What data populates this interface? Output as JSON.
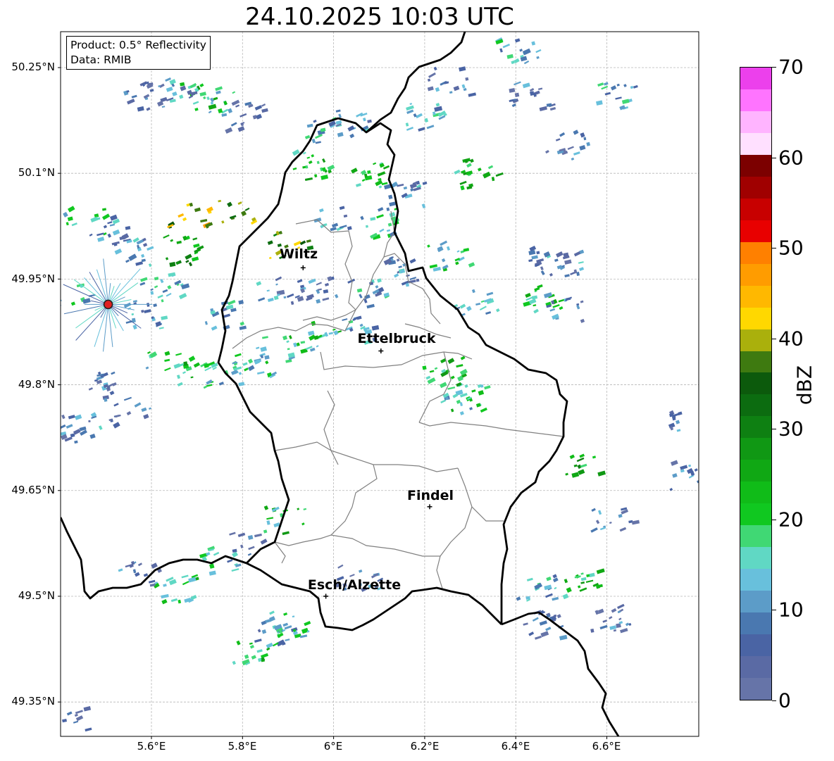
{
  "title": "24.10.2025 10:03 UTC",
  "info": {
    "product": "Product: 0.5° Reflectivity",
    "data": "Data: RMIB"
  },
  "lat_ticks": [
    "50.25°N",
    "50.1°N",
    "49.95°N",
    "49.8°N",
    "49.65°N",
    "49.5°N",
    "49.35°N"
  ],
  "lon_ticks": [
    "5.6°E",
    "5.8°E",
    "6°E",
    "6.2°E",
    "6.4°E",
    "6.6°E"
  ],
  "cities": [
    {
      "name": "Wiltz",
      "lon": 5.933,
      "lat": 49.966
    },
    {
      "name": "Ettelbruck",
      "lon": 6.104,
      "lat": 49.848
    },
    {
      "name": "Findel",
      "lon": 6.211,
      "lat": 49.627
    },
    {
      "name": "Esch/Alzette",
      "lon": 5.983,
      "lat": 49.5
    }
  ],
  "radar_site": {
    "lon": 5.505,
    "lat": 49.914
  },
  "colorbar": {
    "label": "dBZ",
    "ticks": [
      "0",
      "10",
      "20",
      "30",
      "40",
      "50",
      "60",
      "70"
    ],
    "min": 0,
    "max": 70,
    "colors": [
      "#6674a8",
      "#5a6aa4",
      "#4a64a4",
      "#4a78b0",
      "#5c9cc8",
      "#68c0dc",
      "#60d8c4",
      "#40d874",
      "#10c820",
      "#10bc18",
      "#10a814",
      "#109814",
      "#0e8012",
      "#0c6c10",
      "#0c5a0c",
      "#3e7a10",
      "#aab00c",
      "#ffd800",
      "#ffb800",
      "#ff9c00",
      "#ff8000",
      "#e80000",
      "#c80000",
      "#a00000",
      "#7c0000",
      "#ffe0ff",
      "#ffb4ff",
      "#ff74ff",
      "#ec40ec"
    ]
  },
  "echoes": [
    {
      "lon": 5.7,
      "lat": 50.21,
      "dbz": 22
    },
    {
      "lon": 5.75,
      "lat": 50.2,
      "dbz": 18
    },
    {
      "lon": 5.64,
      "lat": 50.22,
      "dbz": 10
    },
    {
      "lon": 5.58,
      "lat": 50.21,
      "dbz": 8
    },
    {
      "lon": 5.8,
      "lat": 50.18,
      "dbz": 6
    },
    {
      "lon": 5.45,
      "lat": 50.03,
      "dbz": 20
    },
    {
      "lon": 5.5,
      "lat": 50.02,
      "dbz": 12
    },
    {
      "lon": 5.66,
      "lat": 49.99,
      "dbz": 28
    },
    {
      "lon": 5.62,
      "lat": 49.94,
      "dbz": 14
    },
    {
      "lon": 5.42,
      "lat": 49.93,
      "dbz": 16
    },
    {
      "lon": 5.58,
      "lat": 49.9,
      "dbz": 12
    },
    {
      "lon": 5.63,
      "lat": 49.83,
      "dbz": 18
    },
    {
      "lon": 5.7,
      "lat": 49.82,
      "dbz": 22
    },
    {
      "lon": 5.76,
      "lat": 49.81,
      "dbz": 16
    },
    {
      "lon": 5.5,
      "lat": 49.8,
      "dbz": 8
    },
    {
      "lon": 5.55,
      "lat": 49.76,
      "dbz": 6
    },
    {
      "lon": 5.44,
      "lat": 49.74,
      "dbz": 10
    },
    {
      "lon": 5.86,
      "lat": 49.85,
      "dbz": 18
    },
    {
      "lon": 5.82,
      "lat": 49.83,
      "dbz": 16
    },
    {
      "lon": 5.92,
      "lat": 49.86,
      "dbz": 20
    },
    {
      "lon": 5.97,
      "lat": 49.87,
      "dbz": 22
    },
    {
      "lon": 6.04,
      "lat": 49.88,
      "dbz": 14
    },
    {
      "lon": 5.87,
      "lat": 49.93,
      "dbz": 10
    },
    {
      "lon": 5.96,
      "lat": 49.94,
      "dbz": 8
    },
    {
      "lon": 6.07,
      "lat": 49.93,
      "dbz": 12
    },
    {
      "lon": 5.97,
      "lat": 50.16,
      "dbz": 14
    },
    {
      "lon": 6.03,
      "lat": 50.17,
      "dbz": 10
    },
    {
      "lon": 5.95,
      "lat": 50.11,
      "dbz": 22
    },
    {
      "lon": 6.08,
      "lat": 50.1,
      "dbz": 24
    },
    {
      "lon": 6.0,
      "lat": 50.04,
      "dbz": 12
    },
    {
      "lon": 6.1,
      "lat": 50.03,
      "dbz": 16
    },
    {
      "lon": 5.9,
      "lat": 50.0,
      "dbz": 38
    },
    {
      "lon": 5.79,
      "lat": 50.05,
      "dbz": 40
    },
    {
      "lon": 5.68,
      "lat": 50.04,
      "dbz": 42
    },
    {
      "lon": 6.15,
      "lat": 50.07,
      "dbz": 10
    },
    {
      "lon": 6.25,
      "lat": 50.23,
      "dbz": 8
    },
    {
      "lon": 6.2,
      "lat": 50.18,
      "dbz": 12
    },
    {
      "lon": 6.4,
      "lat": 50.27,
      "dbz": 14
    },
    {
      "lon": 6.43,
      "lat": 50.21,
      "dbz": 8
    },
    {
      "lon": 6.31,
      "lat": 50.1,
      "dbz": 24
    },
    {
      "lon": 6.25,
      "lat": 49.98,
      "dbz": 18
    },
    {
      "lon": 6.47,
      "lat": 49.98,
      "dbz": 8
    },
    {
      "lon": 6.5,
      "lat": 49.97,
      "dbz": 10
    },
    {
      "lon": 6.46,
      "lat": 49.92,
      "dbz": 22
    },
    {
      "lon": 6.5,
      "lat": 49.91,
      "dbz": 8
    },
    {
      "lon": 6.31,
      "lat": 49.92,
      "dbz": 16
    },
    {
      "lon": 6.3,
      "lat": 49.78,
      "dbz": 20
    },
    {
      "lon": 6.27,
      "lat": 49.78,
      "dbz": 14
    },
    {
      "lon": 6.24,
      "lat": 49.82,
      "dbz": 24
    },
    {
      "lon": 6.54,
      "lat": 49.69,
      "dbz": 26
    },
    {
      "lon": 6.78,
      "lat": 49.75,
      "dbz": 8
    },
    {
      "lon": 6.77,
      "lat": 49.67,
      "dbz": 10
    },
    {
      "lon": 6.61,
      "lat": 49.61,
      "dbz": 8
    },
    {
      "lon": 5.89,
      "lat": 49.61,
      "dbz": 22
    },
    {
      "lon": 5.74,
      "lat": 49.55,
      "dbz": 18
    },
    {
      "lon": 5.65,
      "lat": 49.51,
      "dbz": 20
    },
    {
      "lon": 5.57,
      "lat": 49.53,
      "dbz": 8
    },
    {
      "lon": 5.87,
      "lat": 49.45,
      "dbz": 12
    },
    {
      "lon": 5.82,
      "lat": 49.42,
      "dbz": 22
    },
    {
      "lon": 5.9,
      "lat": 49.46,
      "dbz": 16
    },
    {
      "lon": 6.05,
      "lat": 49.53,
      "dbz": 8
    },
    {
      "lon": 6.44,
      "lat": 49.51,
      "dbz": 14
    },
    {
      "lon": 6.46,
      "lat": 49.46,
      "dbz": 8
    },
    {
      "lon": 6.54,
      "lat": 49.52,
      "dbz": 22
    },
    {
      "lon": 6.61,
      "lat": 49.47,
      "dbz": 8
    },
    {
      "lon": 5.8,
      "lat": 49.57,
      "dbz": 6
    },
    {
      "lon": 5.41,
      "lat": 49.33,
      "dbz": 6
    },
    {
      "lon": 6.62,
      "lat": 50.21,
      "dbz": 14
    },
    {
      "lon": 6.51,
      "lat": 50.14,
      "dbz": 8
    },
    {
      "lon": 6.14,
      "lat": 49.96,
      "dbz": 10
    },
    {
      "lon": 5.55,
      "lat": 49.99,
      "dbz": 10
    },
    {
      "lon": 5.75,
      "lat": 49.9,
      "dbz": 12
    }
  ]
}
